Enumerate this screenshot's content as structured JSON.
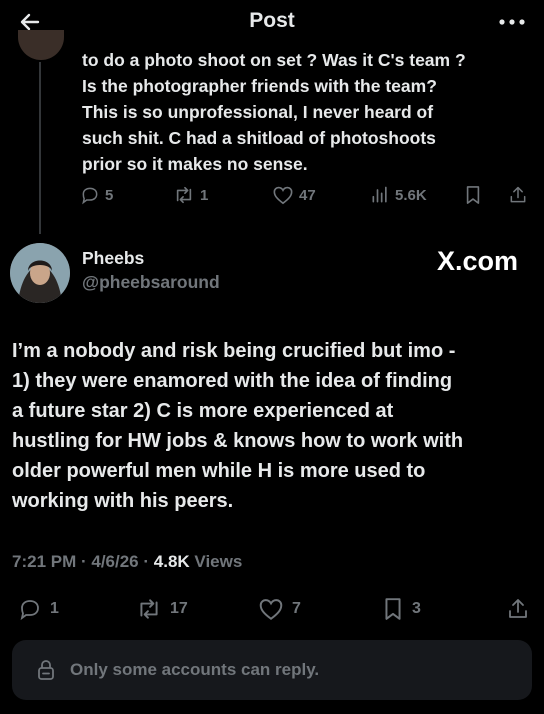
{
  "header": {
    "title": "Post",
    "back_icon": "arrow-left-icon",
    "more_icon": "more-horizontal-icon"
  },
  "parent_post": {
    "text_lines": [
      "to do a photo shoot on set ? Was  it C's team ?",
      "Is the photographer friends with the team?",
      "This is so unprofessional,  I never heard of",
      "such shit. C had a shitload of photoshoots",
      "prior so it makes no sense."
    ],
    "actions": {
      "replies": "5",
      "reposts": "1",
      "likes": "47",
      "views": "5.6K"
    }
  },
  "author": {
    "name": "Pheebs",
    "handle": "@pheebsaround"
  },
  "watermark": "X.com",
  "main_post": {
    "text_lines": [
      "I’m a nobody and risk being crucified but imo -",
      "1) they were enamored with the idea of finding",
      "a future star 2) C is more experienced at",
      "hustling for HW jobs & knows how to work with",
      "older powerful men while H is more used to",
      "working with his peers."
    ],
    "time": "7:21 PM",
    "date": "4/6/26",
    "views_count": "4.8K",
    "views_label": "Views",
    "actions": {
      "replies": "1",
      "reposts": "17",
      "likes": "7",
      "bookmarks": "3"
    }
  },
  "reply_restriction": {
    "text": "Only some accounts can reply.",
    "icon": "lock-icon"
  },
  "colors": {
    "background": "#000000",
    "text_primary": "#e7e9ea",
    "text_secondary": "#71767b",
    "reply_bar_bg": "#16181c"
  }
}
